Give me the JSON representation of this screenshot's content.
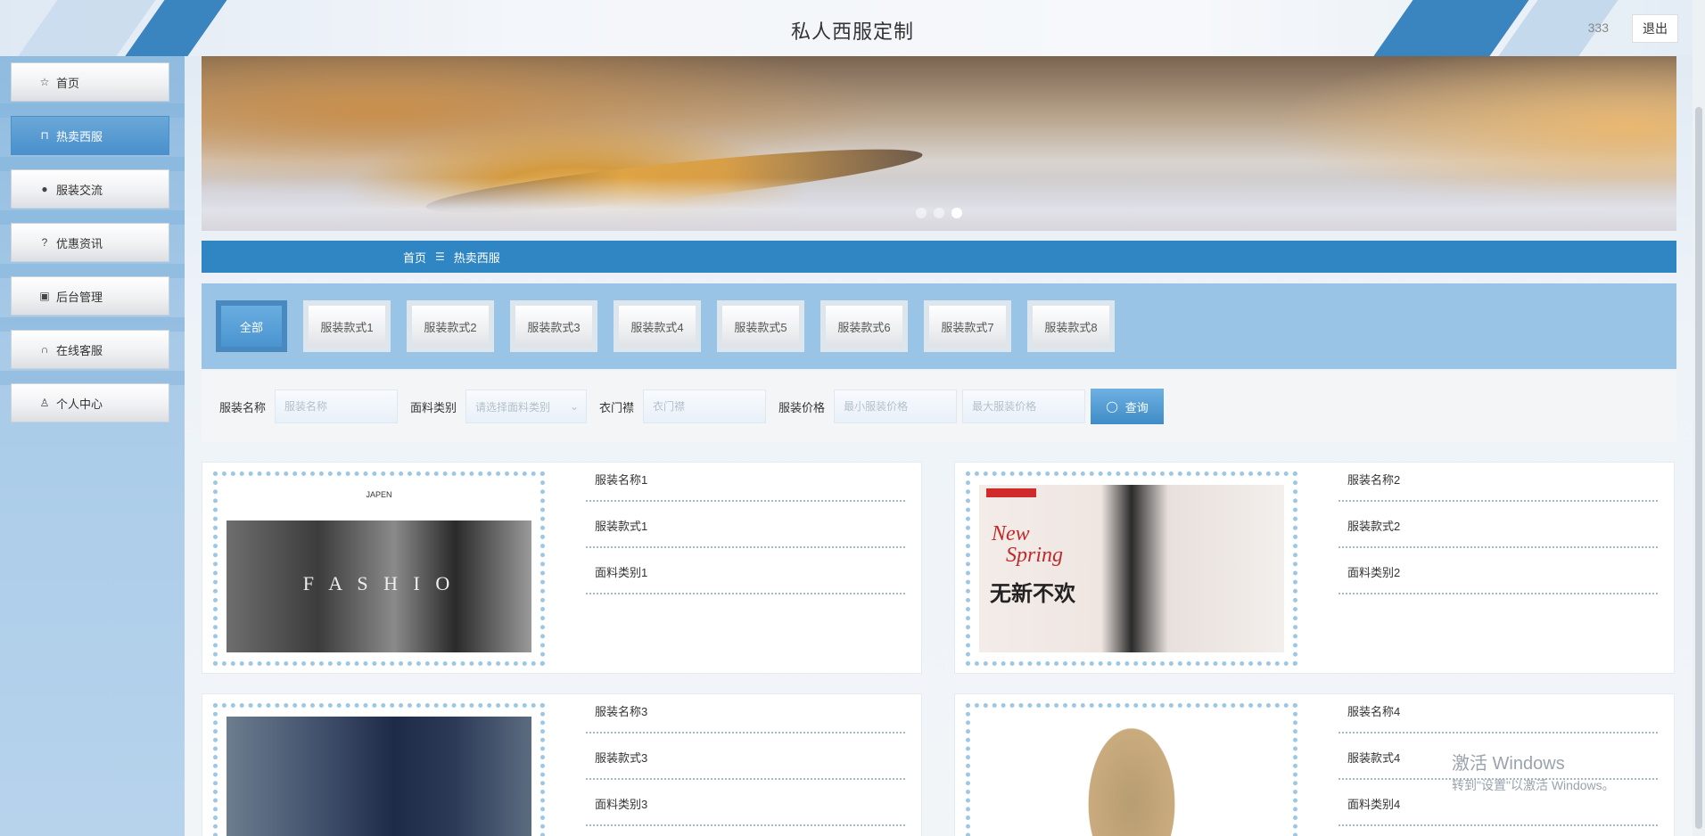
{
  "header": {
    "title": "私人西服定制",
    "user": "333",
    "logout_label": "退出"
  },
  "sidebar": {
    "items": [
      {
        "label": "首页",
        "icon": "star-icon"
      },
      {
        "label": "热卖西服",
        "icon": "bag-icon",
        "active": true
      },
      {
        "label": "服装交流",
        "icon": "alert-icon"
      },
      {
        "label": "优惠资讯",
        "icon": "question-icon"
      },
      {
        "label": "后台管理",
        "icon": "briefcase-icon"
      },
      {
        "label": "在线客服",
        "icon": "headset-icon"
      },
      {
        "label": "个人中心",
        "icon": "user-icon"
      }
    ]
  },
  "banner": {
    "slides": 3,
    "active_slide": 3
  },
  "breadcrumb": {
    "home": "首页",
    "separator": "☰",
    "current": "热卖西服"
  },
  "tabs": [
    "全部",
    "服装款式1",
    "服装款式2",
    "服装款式3",
    "服装款式4",
    "服装款式5",
    "服装款式6",
    "服装款式7",
    "服装款式8"
  ],
  "search": {
    "name_label": "服装名称",
    "name_placeholder": "服装名称",
    "fabric_label": "面料类别",
    "fabric_placeholder": "请选择面料类别",
    "placket_label": "衣门襟",
    "placket_placeholder": "衣门襟",
    "price_label": "服装价格",
    "min_price_placeholder": "最小服装价格",
    "max_price_placeholder": "最大服装价格",
    "button_label": "查询"
  },
  "products": [
    {
      "name": "服装名称1",
      "style": "服装款式1",
      "fabric": "面料类别1"
    },
    {
      "name": "服装名称2",
      "style": "服装款式2",
      "fabric": "面料类别2"
    },
    {
      "name": "服装名称3",
      "style": "服装款式3",
      "fabric": "面料类别3"
    },
    {
      "name": "服装名称4",
      "style": "服装款式4",
      "fabric": "面料类别4"
    }
  ],
  "product_image_text": {
    "p1_brand": "JAPEN",
    "p1_word": "F A S H I O",
    "p2_word1": "New",
    "p2_word2": "Spring",
    "p2_word3": "无新不欢"
  },
  "watermark": {
    "line1": "激活 Windows",
    "line2": "转到\"设置\"以激活 Windows。"
  },
  "colors": {
    "accent": "#2f86c2",
    "sidebar": "#a9cbe8",
    "active": "#4a90cc"
  }
}
